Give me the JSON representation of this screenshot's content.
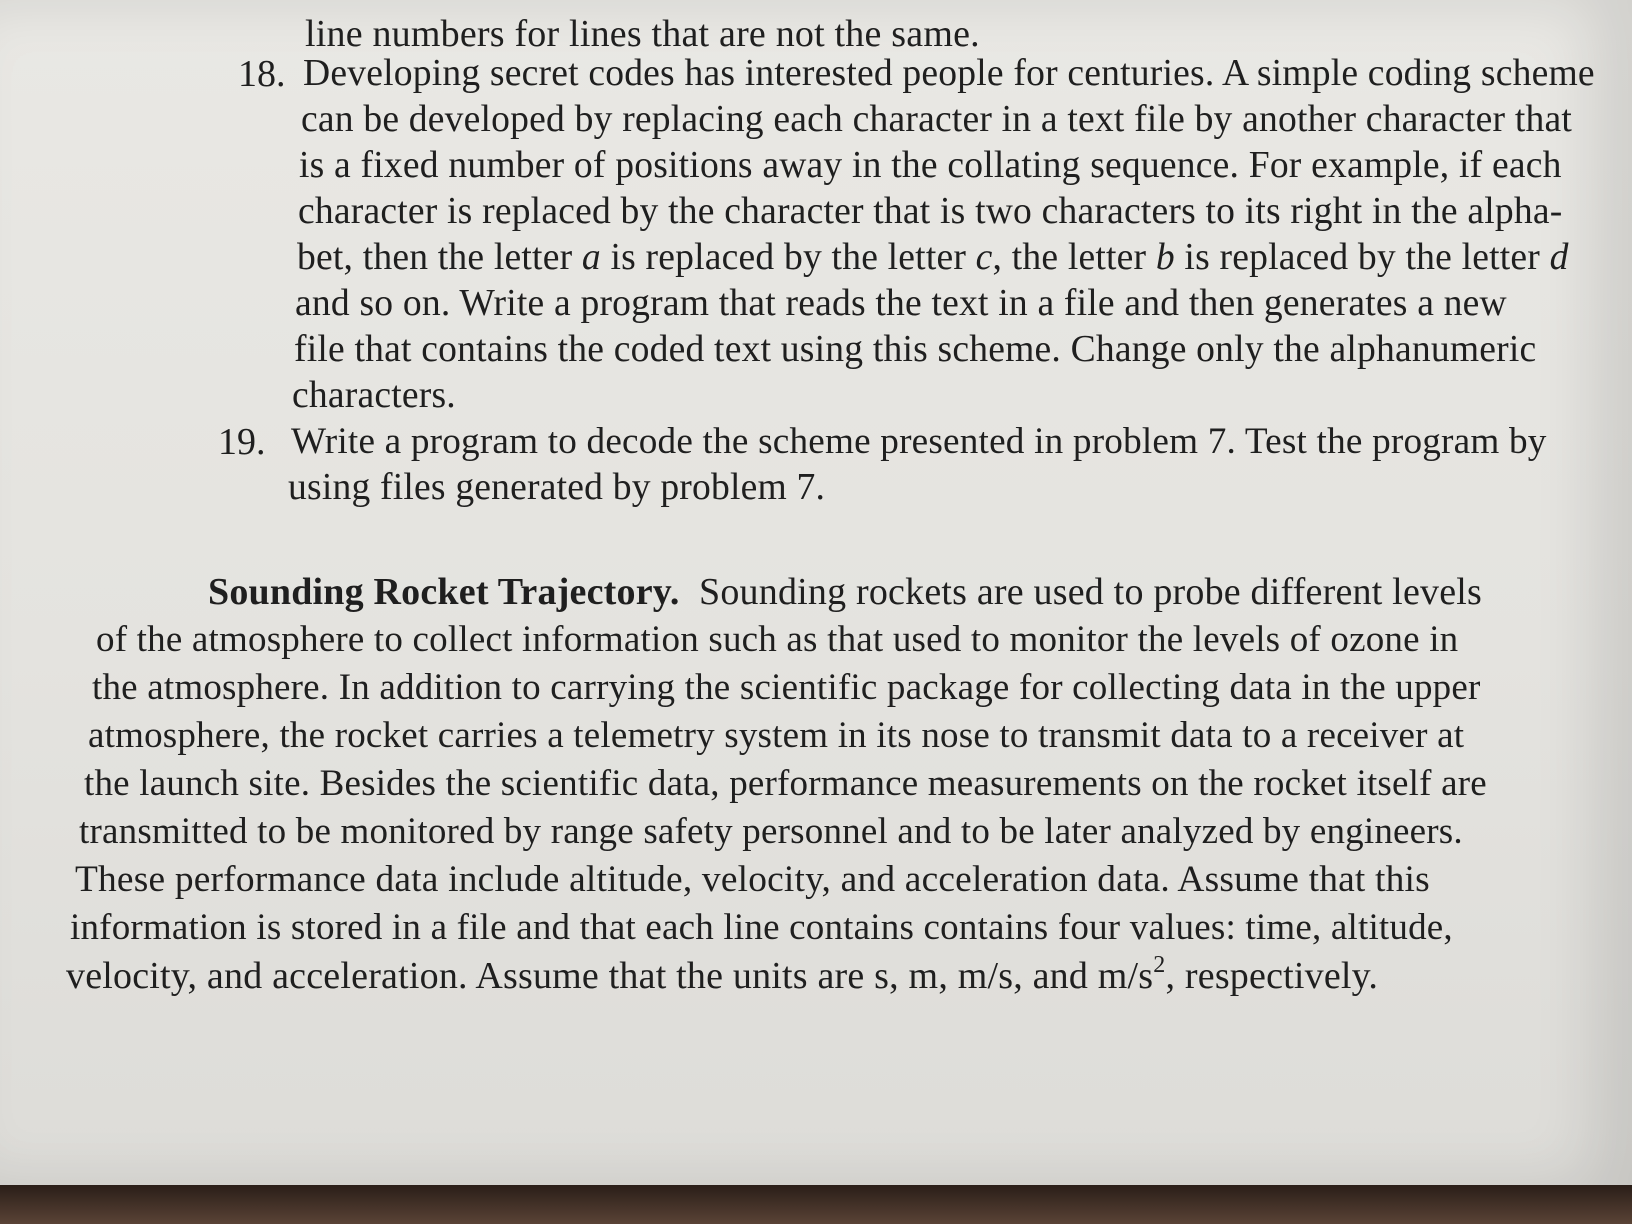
{
  "prev_item": {
    "tail_line": "line numbers for lines that are not the same."
  },
  "item_18": {
    "number": "18.",
    "line1": "Developing secret codes has interested people for centuries. A simple coding scheme",
    "line2": "can be developed by replacing each character in a text file by another character that",
    "line3": "is a fixed number of positions away in the collating sequence. For example, if each",
    "line4": "character is replaced by the character that is two characters to its right in the alpha-",
    "line5_a": "bet, then the letter ",
    "line5_var1": "a",
    "line5_b": " is replaced by the letter ",
    "line5_var2": "c",
    "line5_c": ", the letter ",
    "line5_var3": "b",
    "line5_d": " is replaced by the letter ",
    "line5_var4": "d",
    "line6": "and so on. Write a program that reads the text in a file and then generates a new",
    "line7": "file that contains the coded text using this scheme. Change only the alphanumeric",
    "line8": "characters."
  },
  "item_19": {
    "number": "19.",
    "line1": "Write a program to decode the scheme presented in problem 7. Test the program by",
    "line2": "using files generated by problem 7."
  },
  "section": {
    "heading": "Sounding Rocket Trajectory.",
    "line1": "Sounding rockets are used to probe different levels",
    "line2": "of the atmosphere to collect information such as that used to monitor the levels of ozone in",
    "line3": "the atmosphere. In addition to carrying the scientific package for collecting data in the upper",
    "line4": "atmosphere, the rocket carries a telemetry system in its nose to transmit data to a receiver at",
    "line5": "the launch site. Besides the scientific data, performance measurements on the rocket itself are",
    "line6": "transmitted to be monitored by range safety personnel and to be later analyzed by engineers.",
    "line7": "These performance data include altitude, velocity, and acceleration data. Assume that this",
    "line8": "information is stored in a file and that each line contains contains four values: time, altitude,",
    "line9_a": "velocity, and acceleration. Assume that the units are s, m, m/s, and m/s",
    "line9_sup": "2",
    "line9_b": ", respectively."
  }
}
